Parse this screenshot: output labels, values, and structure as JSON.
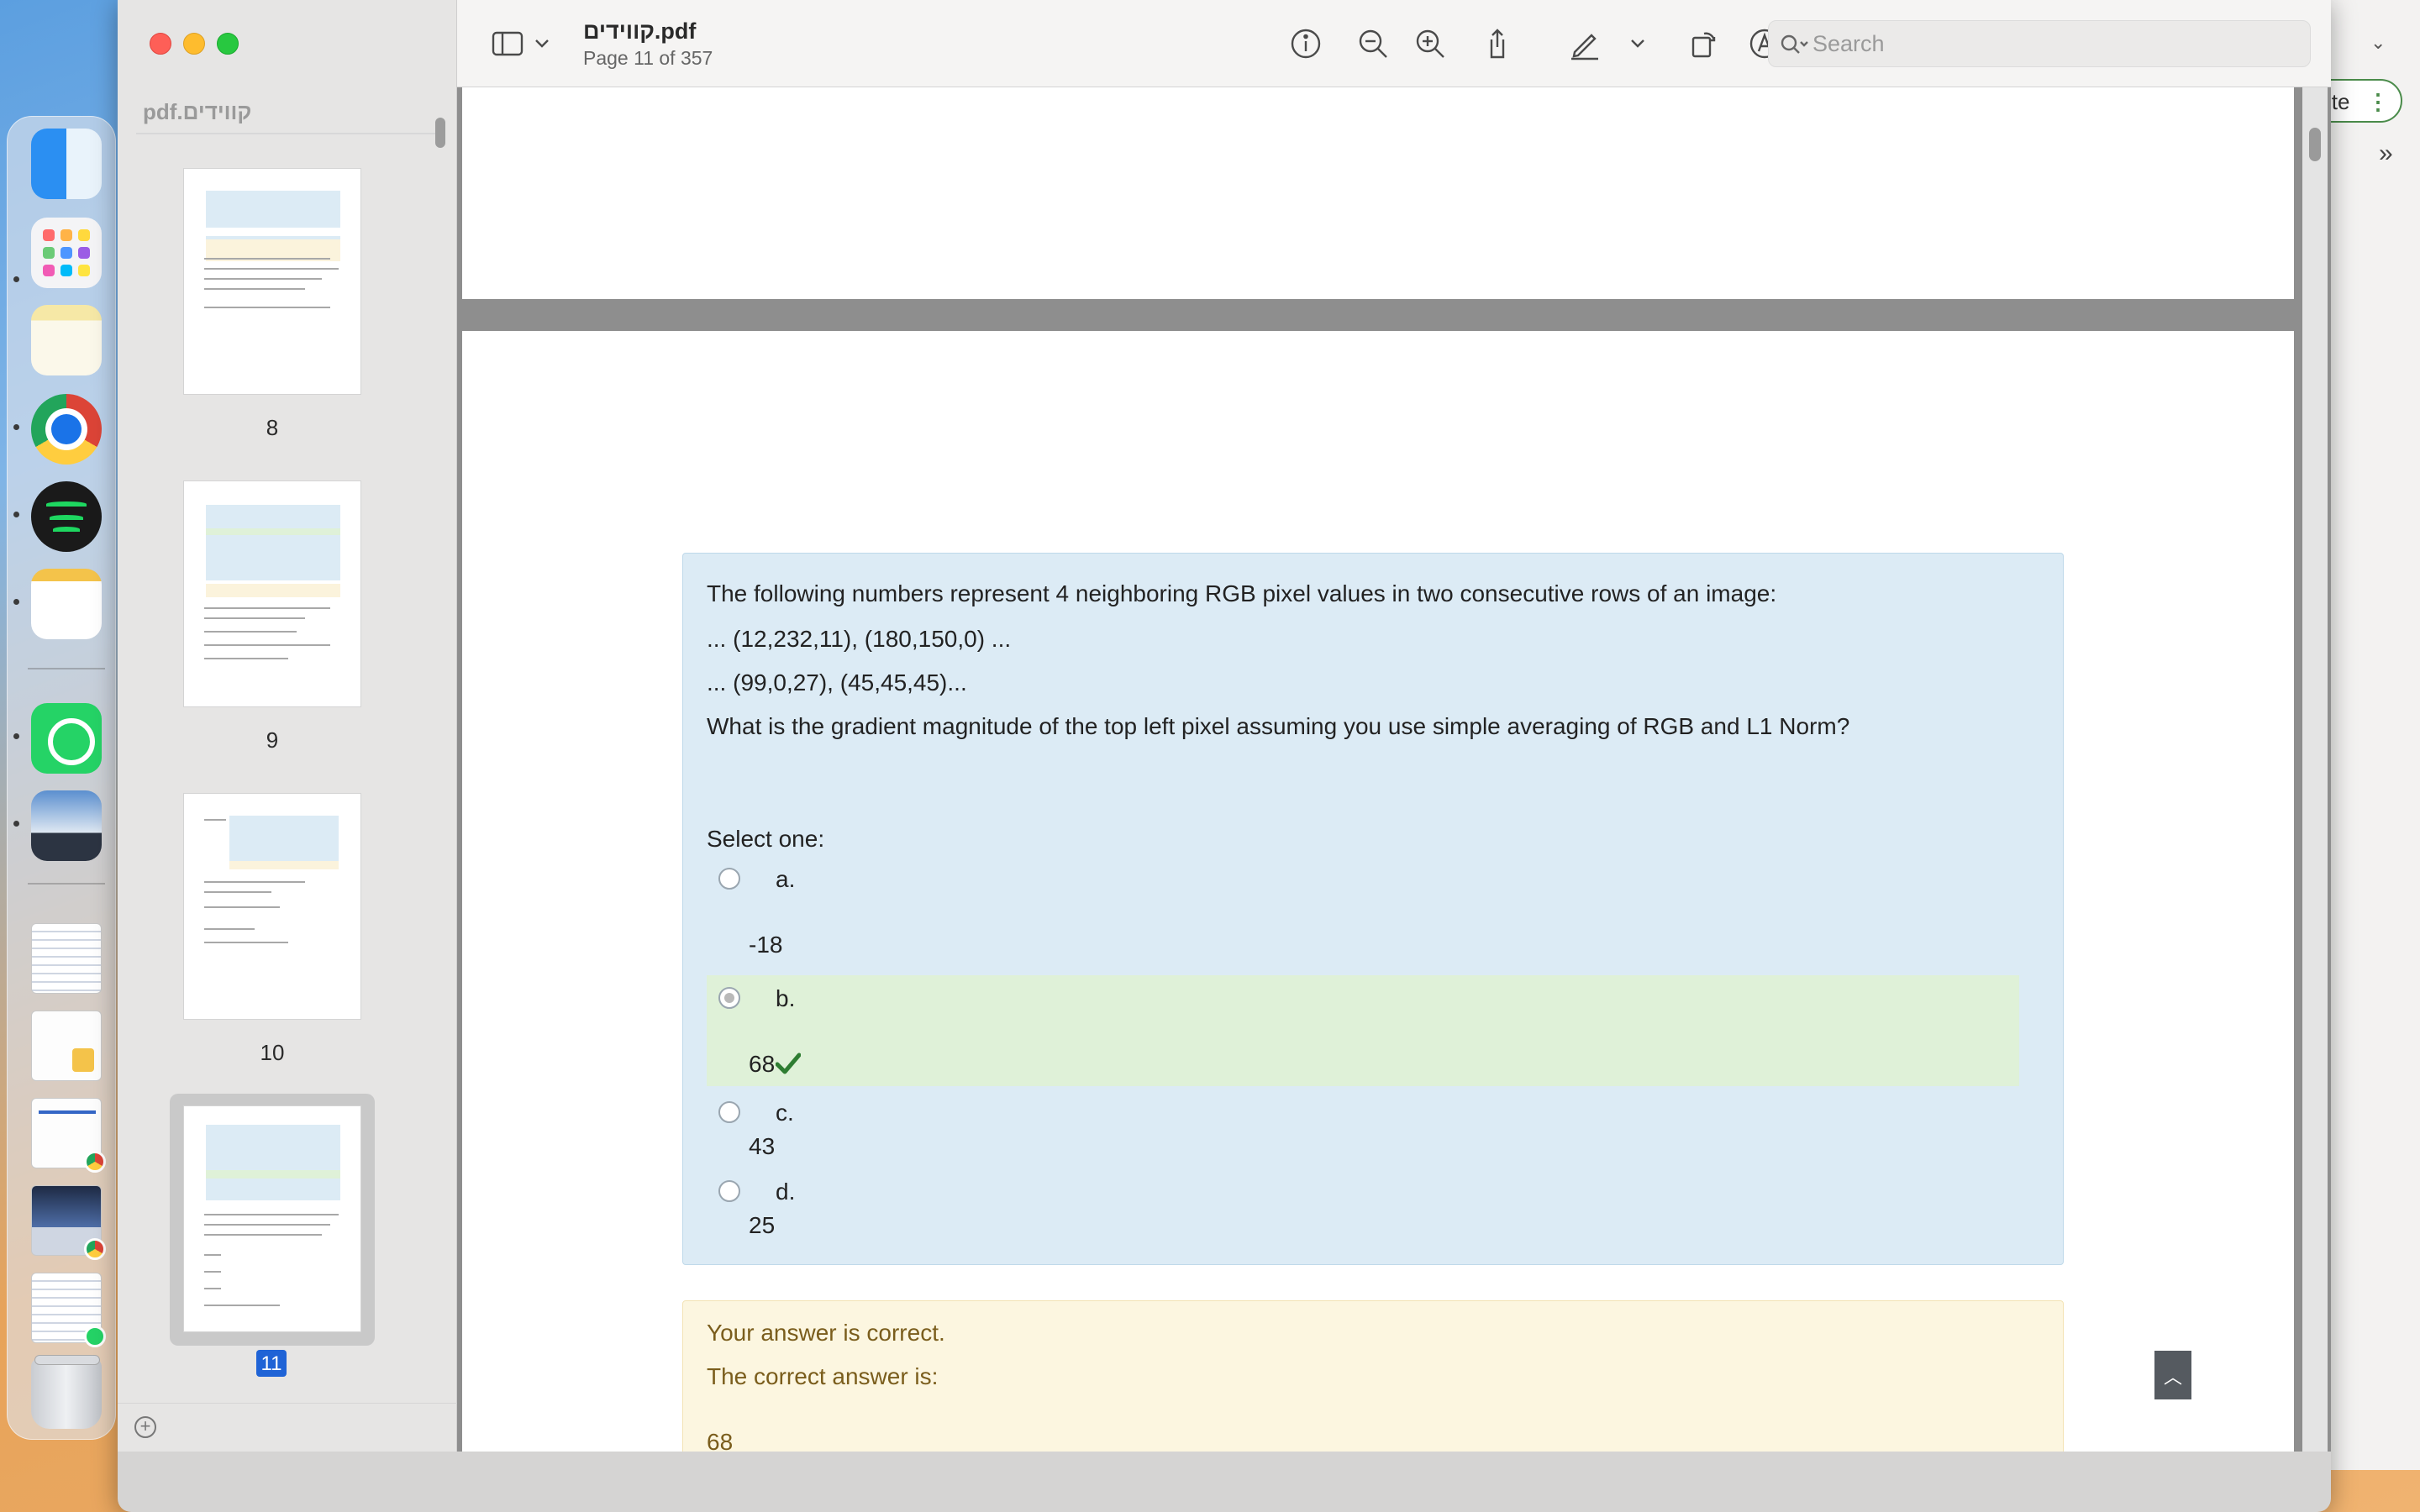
{
  "window": {
    "file_name": "קווידים.pdf",
    "page_indicator": "Page 11 of 357"
  },
  "toolbar": {
    "search_placeholder": "Search"
  },
  "sidebar": {
    "title": "קווידים.pdf",
    "thumbnails": [
      {
        "label": "8"
      },
      {
        "label": "9"
      },
      {
        "label": "10"
      },
      {
        "label": "11",
        "selected": true
      }
    ]
  },
  "question": {
    "lines": [
      "The following numbers represent 4 neighboring RGB pixel values in two consecutive rows of an image:",
      "... (12,232,11), (180,150,0) ...",
      "... (99,0,27), (45,45,45)...",
      "What is the gradient magnitude of the top left pixel assuming you use simple averaging of RGB and L1 Norm?"
    ],
    "select_prompt": "Select one:",
    "options": [
      {
        "letter": "a.",
        "value": "-18"
      },
      {
        "letter": "b.",
        "value": "68",
        "selected": true,
        "correct": true
      },
      {
        "letter": "c.",
        "value": "43"
      },
      {
        "letter": "d.",
        "value": "25"
      }
    ]
  },
  "feedback": {
    "result": "Your answer is correct.",
    "correct_label": "The correct answer is:",
    "correct_value": "68"
  },
  "background_app": {
    "chip_text": "ite"
  },
  "colors": {
    "question_bg": "#dcebf5",
    "correct_option_bg": "#dff1d8",
    "feedback_bg": "#fcf6e0",
    "check_green": "#2e7d32",
    "selected_page_badge": "#1f63d6"
  }
}
